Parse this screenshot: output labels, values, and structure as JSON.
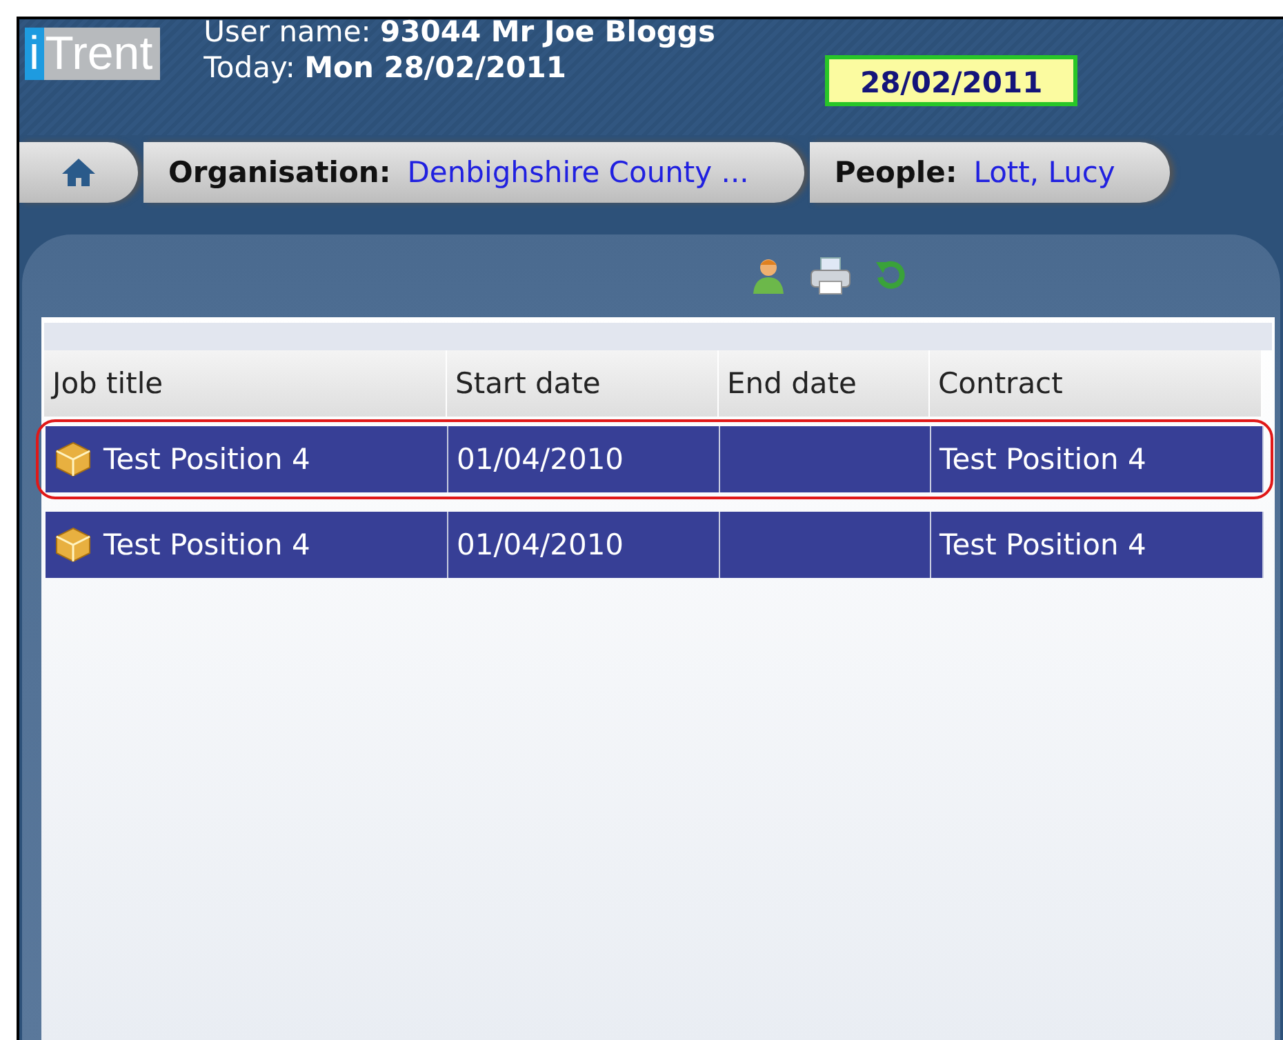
{
  "header": {
    "logo": {
      "prefix": "i",
      "name": "Trent"
    },
    "user_label": "User name:",
    "user_value": "93044 Mr Joe Bloggs",
    "today_label": "Today:",
    "today_value": "Mon 28/02/2011",
    "effective_value": "28/02/2011"
  },
  "breadcrumb": [
    {
      "label": "Organisation:",
      "value": "Denbighshire County ..."
    },
    {
      "label": "People:",
      "value": "Lott, Lucy"
    }
  ],
  "table": {
    "columns": [
      "Job title",
      "Start date",
      "End date",
      "Contract"
    ],
    "rows": [
      {
        "cells": [
          "Test Position 4",
          "01/04/2010",
          "",
          "Test Position 4"
        ],
        "selected": true,
        "highlighted": true
      },
      {
        "cells": [
          "Test Position 4",
          "01/04/2010",
          "",
          "Test Position 4"
        ],
        "selected": true,
        "highlighted": false
      }
    ]
  }
}
